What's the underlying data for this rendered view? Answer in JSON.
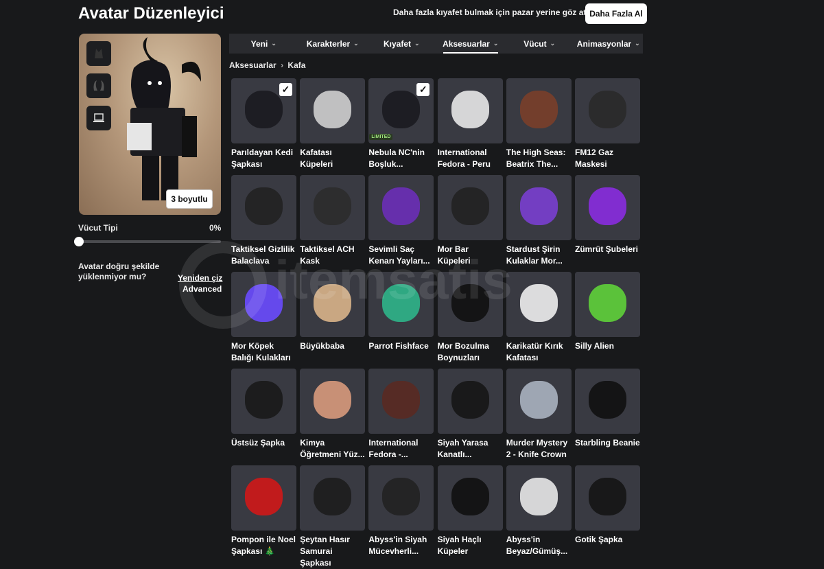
{
  "header": {
    "title": "Avatar Düzenleyici",
    "promo": "Daha fazla kıyafet bulmak için pazar yerine göz at!",
    "get_more": "Daha Fazla Al"
  },
  "preview": {
    "button_3d": "3 boyutlu"
  },
  "body_type": {
    "label": "Vücut Tipi",
    "value": "0%",
    "level": 0
  },
  "help": {
    "text": "Avatar doğru şekilde yüklenmiyor mu?",
    "redraw": "Yeniden çiz",
    "advanced": "Advanced"
  },
  "tabs": [
    {
      "label": "Yeni"
    },
    {
      "label": "Karakterler"
    },
    {
      "label": "Kıyafet"
    },
    {
      "label": "Aksesuarlar",
      "active": true
    },
    {
      "label": "Vücut"
    },
    {
      "label": "Animasyonlar"
    }
  ],
  "breadcrumb": {
    "parent": "Aksesuarlar",
    "current": "Kafa"
  },
  "items": [
    {
      "name": "Parıldayan Kedi Şapkası",
      "checked": true
    },
    {
      "name": "Kafatası Küpeleri"
    },
    {
      "name": "Nebula NC'nin Boşluk...",
      "checked": true,
      "limited": true
    },
    {
      "name": "International Fedora - Peru"
    },
    {
      "name": "The High Seas: Beatrix The..."
    },
    {
      "name": "FM12 Gaz Maskesi"
    },
    {
      "name": "Taktiksel Gizlilik Balaclava"
    },
    {
      "name": "Taktiksel ACH Kask"
    },
    {
      "name": "Sevimli Saç Kenarı Yayları..."
    },
    {
      "name": "Mor Bar Küpeleri"
    },
    {
      "name": "Stardust Şirin Kulaklar Mor..."
    },
    {
      "name": "Zümrüt Şubeleri"
    },
    {
      "name": "Mor Köpek Balığı Kulakları"
    },
    {
      "name": "Büyükbaba"
    },
    {
      "name": "Parrot Fishface"
    },
    {
      "name": "Mor Bozulma Boynuzları"
    },
    {
      "name": "Karikatür Kırık Kafatası"
    },
    {
      "name": "Silly Alien"
    },
    {
      "name": "Üstsüz Şapka"
    },
    {
      "name": "Kimya Öğretmeni Yüz..."
    },
    {
      "name": "International Fedora -..."
    },
    {
      "name": "Siyah Yarasa Kanatlı..."
    },
    {
      "name": "Murder Mystery 2 - Knife Crown"
    },
    {
      "name": "Starbling Beanie"
    },
    {
      "name": "Pompon ile Noel Şapkası 🎄"
    },
    {
      "name": "Şeytan Hasır Samurai Şapkası"
    },
    {
      "name": "Abyss'in Siyah Mücevherli..."
    },
    {
      "name": "Siyah Haçlı Küpeler"
    },
    {
      "name": "Abyss'in Beyaz/Gümüş..."
    },
    {
      "name": "Gotik Şapka"
    }
  ],
  "labels": {
    "limited": "LIMITED"
  },
  "watermark": "itemsatis",
  "colors": {
    "background": "#18191b",
    "tile": "#393a42",
    "tab_bar": "#2a2b2f",
    "accent_white": "#ffffff"
  }
}
